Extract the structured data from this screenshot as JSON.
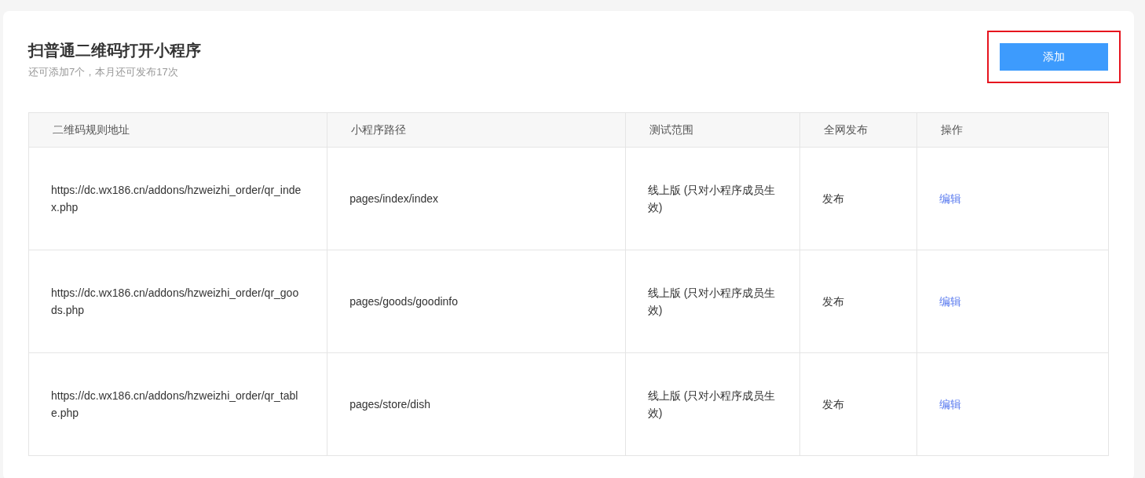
{
  "header": {
    "title": "扫普通二维码打开小程序",
    "subtitle": "还可添加7个，本月还可发布17次"
  },
  "add_button": {
    "label": "添加",
    "highlighted": true
  },
  "table": {
    "columns": [
      "二维码规则地址",
      "小程序路径",
      "测试范围",
      "全网发布",
      "操作"
    ],
    "rows": [
      {
        "rule_url": "https://dc.wx186.cn/addons/hzweizhi_order/qr_index.php",
        "path": "pages/index/index",
        "test_scope": "线上版 (只对小程序成员生效)",
        "publish": "发布",
        "action": "编辑"
      },
      {
        "rule_url": "https://dc.wx186.cn/addons/hzweizhi_order/qr_goods.php",
        "path": "pages/goods/goodinfo",
        "test_scope": "线上版 (只对小程序成员生效)",
        "publish": "发布",
        "action": "编辑"
      },
      {
        "rule_url": "https://dc.wx186.cn/addons/hzweizhi_order/qr_table.php",
        "path": "pages/store/dish",
        "test_scope": "线上版 (只对小程序成员生效)",
        "publish": "发布",
        "action": "编辑"
      }
    ]
  }
}
